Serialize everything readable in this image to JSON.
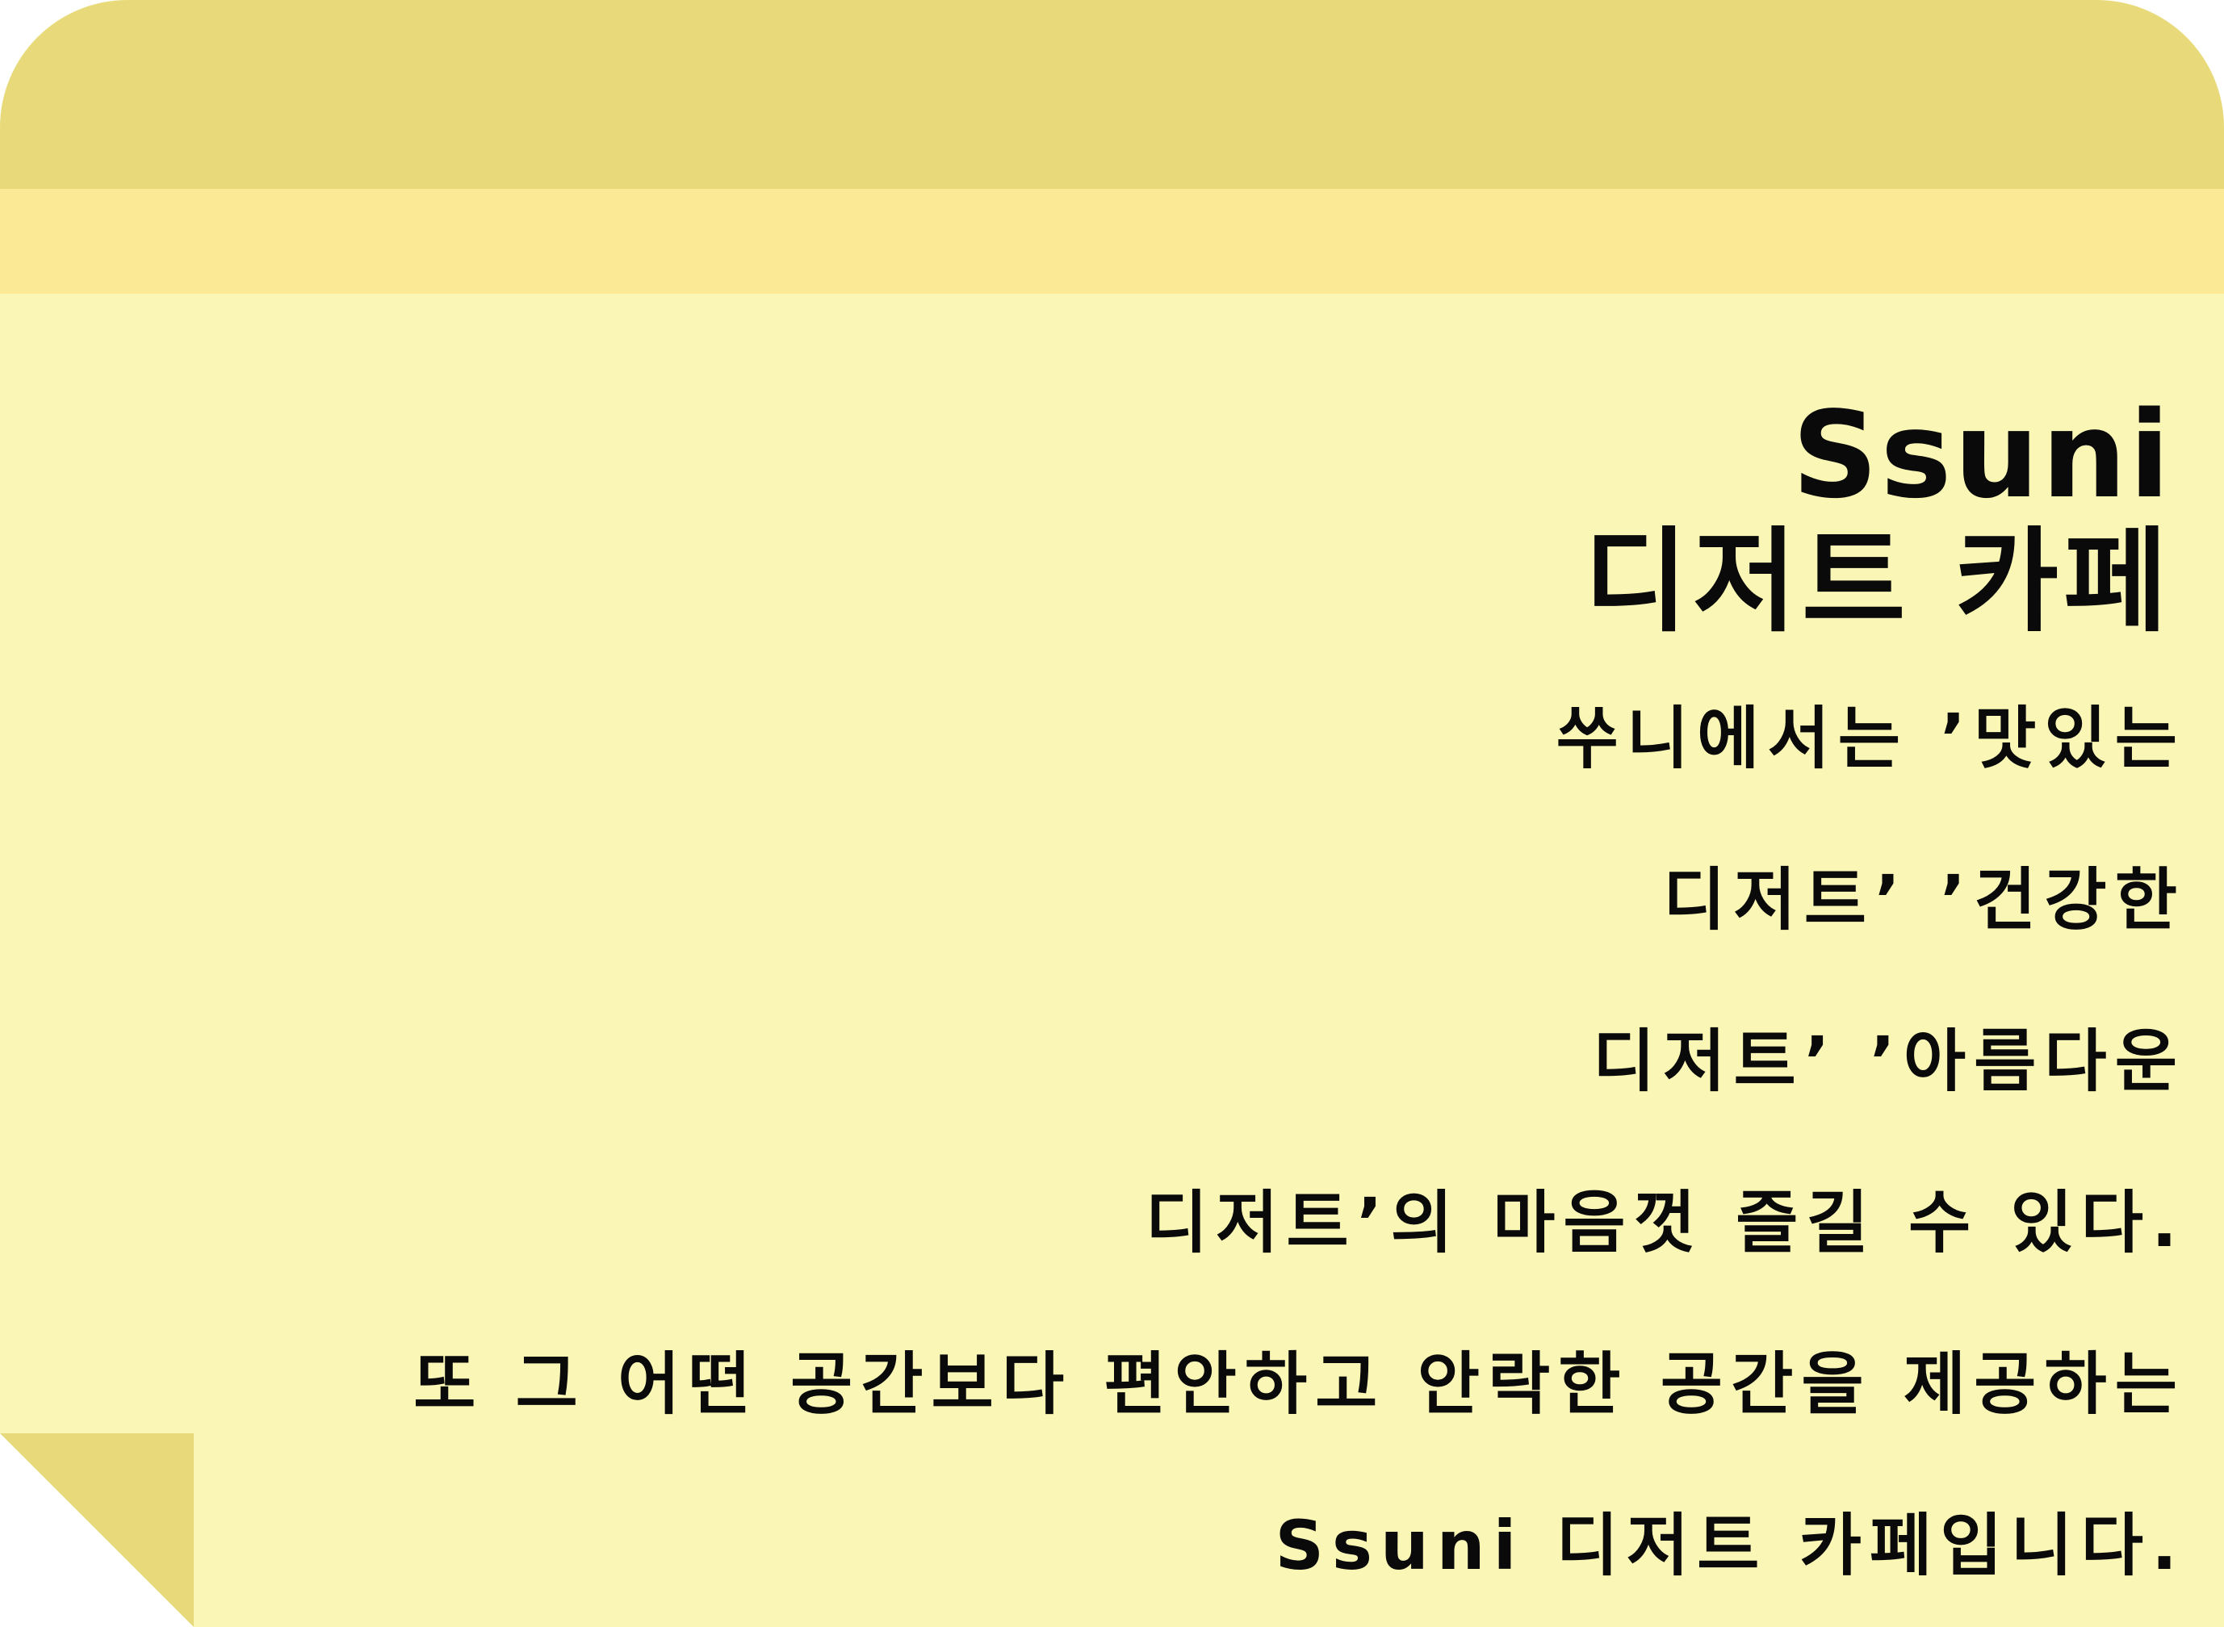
{
  "title": {
    "line1": "Ssuni",
    "line2": "디저트 카페"
  },
  "body_lines": [
    "쑤니에서는 ’맛있는",
    "디저트’ ’건강한",
    "디저트’ ’아름다운",
    "디저트’의 마음껏 즐길 수 있다.",
    "또 그 어떤 공간보다 편안하고 안락한 공간을 제공하는",
    "Ssuni 디저트 카페입니다."
  ],
  "colors": {
    "note_background": "#faf6b6",
    "top_band_dark": "#e8da7a",
    "top_band_light": "#fbe996",
    "fold": "#e8da7a",
    "text": "#0a0a0a"
  }
}
